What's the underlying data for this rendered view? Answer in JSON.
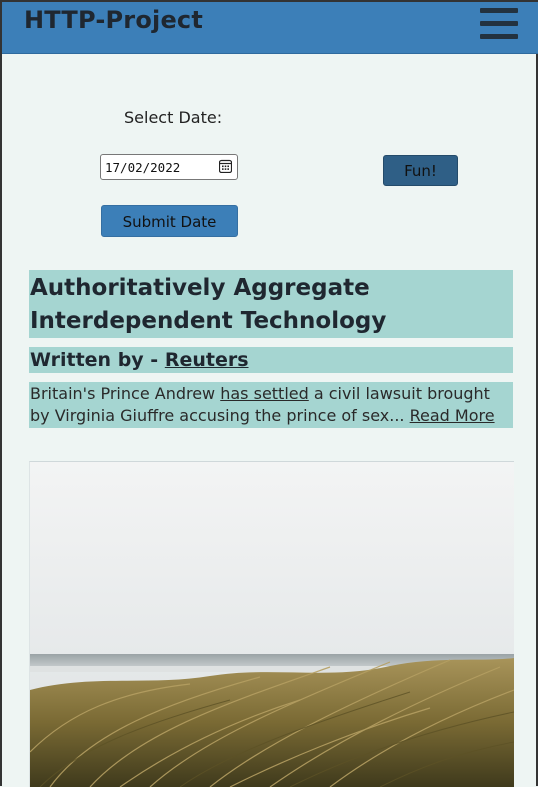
{
  "header": {
    "title": "HTTP-Project",
    "menu_icon": "hamburger-menu-icon"
  },
  "form": {
    "date_label": "Select Date:",
    "date_value": "17/02/2022",
    "fun_label": "Fun!",
    "submit_label": "Submit Date"
  },
  "article": {
    "title": "Authoritatively Aggregate Interdependent Technology",
    "author_prefix": "Written by - ",
    "author_name": "Reuters",
    "summary_prefix": "Britain's Prince Andrew ",
    "summary_link": "has settled",
    "summary_suffix": " a civil lawsuit brought by Virginia Giuffre accusing the prince of sex... ",
    "read_more": "Read More",
    "image_alt": "beach-grass-photo"
  },
  "colors": {
    "header_bg": "#3c7fb8",
    "page_bg": "#eef5f3",
    "highlight_bg": "#a5d5d1",
    "fun_button_bg": "#2f5f86"
  }
}
